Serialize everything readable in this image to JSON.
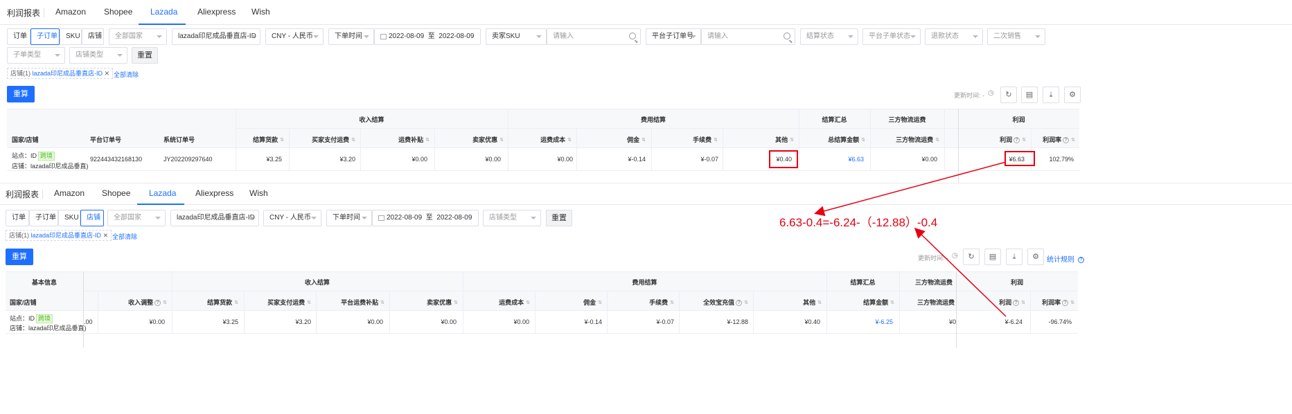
{
  "top": {
    "report_title": "利润报表",
    "tabs": [
      "Amazon",
      "Shopee",
      "Lazada",
      "Aliexpress",
      "Wish"
    ],
    "filters": {
      "seg": [
        "订单",
        "子订单",
        "SKU",
        "店铺"
      ],
      "country_placeholder": "全部国家",
      "store": "lazada印尼成品垂直店-ID",
      "currency": "CNY - 人民币",
      "time_type": "下单时间",
      "date_from": "2022-08-09",
      "date_to_sep": "至",
      "date_to": "2022-08-09",
      "sku_type": "卖家SKU",
      "input_placeholder": "请输入",
      "sub_order_type": "平台子订单号",
      "settle_status": "结算状态",
      "platform_sub_status": "平台子单状态",
      "refund_status": "退款状态",
      "second_sale": "二次销售",
      "sub_order_kind": "子单类型",
      "store_kind": "店铺类型",
      "reset": "重置"
    },
    "chip": {
      "label": "店铺(1)",
      "value": "lazada印尼成品垂直店-ID",
      "close": "✕",
      "clear": "全部清除"
    },
    "recalc": "重算",
    "update_time": "更新时间: -",
    "group_headers": {
      "income": "收入结算",
      "fee": "费用结算",
      "settle_total": "结算汇总",
      "third_party": "三方物流运费",
      "profit": "利润"
    },
    "columns": [
      "国家/店铺",
      "平台订单号",
      "系统订单号",
      "结算货款",
      "买家支付运费",
      "运费补贴",
      "卖家优惠",
      "运费成本",
      "佣金",
      "手续费",
      "其他",
      "总结算金额",
      "三方物流运费",
      "利润",
      "利润率"
    ],
    "row": {
      "site": "站点：ID",
      "tag": "跨境",
      "store": "店铺：lazada印尼成品垂直)",
      "platform_order": "922443432168130",
      "system_order": "JY202209297640",
      "values": [
        "¥3.25",
        "¥3.20",
        "¥0.00",
        "¥0.00",
        "¥0.00",
        "¥-0.14",
        "¥-0.07",
        "¥0.40",
        "¥6.63",
        "¥0.00",
        "¥6.63",
        "102.79%"
      ]
    }
  },
  "bottom": {
    "report_title": "利润报表",
    "tabs": [
      "Amazon",
      "Shopee",
      "Lazada",
      "Aliexpress",
      "Wish"
    ],
    "filters": {
      "seg": [
        "订单",
        "子订单",
        "SKU",
        "店铺"
      ],
      "country_placeholder": "全部国家",
      "store": "lazada印尼成品垂直店-ID",
      "currency": "CNY - 人民币",
      "time_type": "下单时间",
      "date_from": "2022-08-09",
      "date_to_sep": "至",
      "date_to": "2022-08-09",
      "store_kind": "店铺类型",
      "reset": "重置"
    },
    "chip": {
      "label": "店铺(1)",
      "value": "lazada印尼成品垂直店-ID",
      "close": "✕",
      "clear": "全部清除"
    },
    "recalc": "重算",
    "update_time": "更新时间: -",
    "stat_rule": "统计规则",
    "group_headers": {
      "basic": "基本信息",
      "income": "收入结算",
      "fee": "费用结算",
      "settle_total": "结算汇总",
      "third_party": "三方物流运费",
      "profit": "利润"
    },
    "columns": [
      "国家/店铺",
      "收入调整",
      "结算货款",
      "买家支付运费",
      "平台运费补贴",
      "卖家优惠",
      "运费成本",
      "佣金",
      "手续费",
      "全效宝充值",
      "其他",
      "结算金额",
      "三方物流运费",
      "利润",
      "利润率"
    ],
    "row": {
      "site": "站点：ID",
      "tag": "跨境",
      "store": "店铺：lazada印尼成品垂直)",
      "partial": ".00",
      "values": [
        "¥0.00",
        "¥3.25",
        "¥3.20",
        "¥0.00",
        "¥0.00",
        "¥0.00",
        "¥-0.14",
        "¥-0.07",
        "¥-12.88",
        "¥0.40",
        "¥-6.25",
        "¥0",
        "¥-6.24",
        "-96.74%"
      ]
    }
  },
  "annotation": {
    "formula": "6.63-0.4=-6.24-（-12.88）-0.4",
    "color": "#e60012"
  }
}
